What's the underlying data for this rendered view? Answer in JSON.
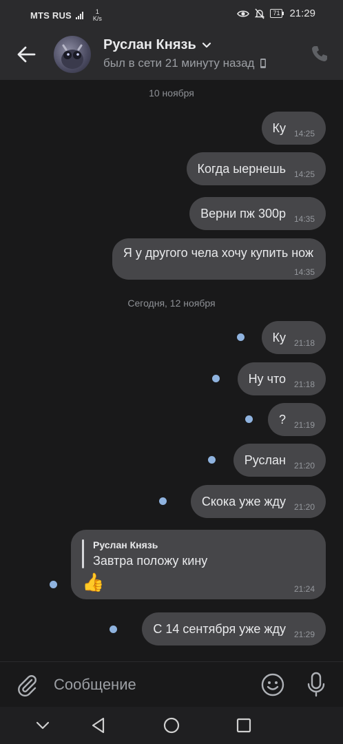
{
  "status_bar": {
    "carrier": "MTS RUS",
    "network_type": "4G",
    "speed_value": "1",
    "speed_unit": "K/s",
    "battery": "71",
    "time": "21:29"
  },
  "header": {
    "contact_name": "Руслан Князь",
    "last_seen": "был в сети 21 минуту назад"
  },
  "chat": {
    "date_1": "10 ноября",
    "date_2": "Сегодня, 12 ноября",
    "messages": [
      {
        "text": "Ку",
        "time": "14:25"
      },
      {
        "text": "Когда ыернешь",
        "time": "14:25"
      },
      {
        "text": "Верни пж 300р",
        "time": "14:35"
      },
      {
        "text": "Я у другого чела хочу купить нож",
        "time": "14:35"
      },
      {
        "text": "Ку",
        "time": "21:18"
      },
      {
        "text": "Ну что",
        "time": "21:18"
      },
      {
        "text": "?",
        "time": "21:19"
      },
      {
        "text": "Руслан",
        "time": "21:20"
      },
      {
        "text": "Скока уже жду",
        "time": "21:20"
      },
      {
        "reply_author": "Руслан Князь",
        "reply_text": "Завтра положу кину",
        "emoji": "👍",
        "time": "21:24"
      },
      {
        "text": "С 14 сентября уже жду",
        "time": "21:29"
      }
    ]
  },
  "composer": {
    "placeholder": "Сообщение"
  },
  "colors": {
    "background": "#19191a",
    "header_bg": "#2b2b2d",
    "bubble_bg": "#464649",
    "unread_dot": "#8fb3df",
    "secondary_text": "#9c9fa4"
  }
}
